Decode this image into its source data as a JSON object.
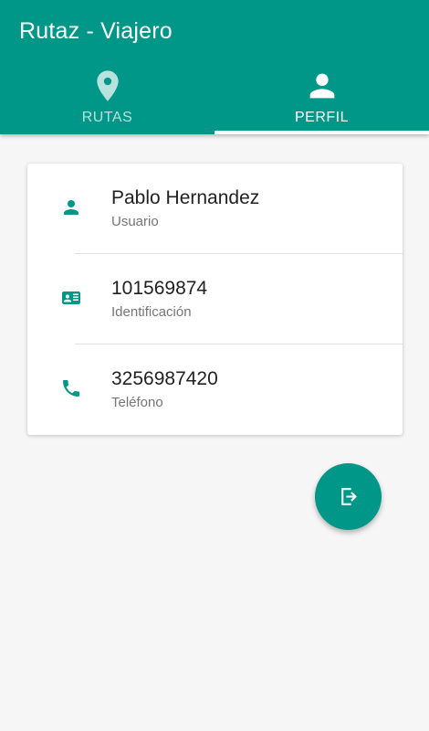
{
  "app": {
    "title": "Rutaz - Viajero",
    "accent_color": "#009688"
  },
  "tabs": [
    {
      "label": "RUTAS",
      "icon": "location-pin-icon",
      "active": false
    },
    {
      "label": "PERFIL",
      "icon": "person-icon",
      "active": true
    }
  ],
  "profile": {
    "rows": [
      {
        "value": "Pablo Hernandez",
        "label": "Usuario",
        "icon": "person-icon"
      },
      {
        "value": "101569874",
        "label": "Identificación",
        "icon": "id-card-icon"
      },
      {
        "value": "3256987420",
        "label": "Teléfono",
        "icon": "phone-icon"
      }
    ]
  },
  "fab": {
    "icon": "logout-icon"
  }
}
